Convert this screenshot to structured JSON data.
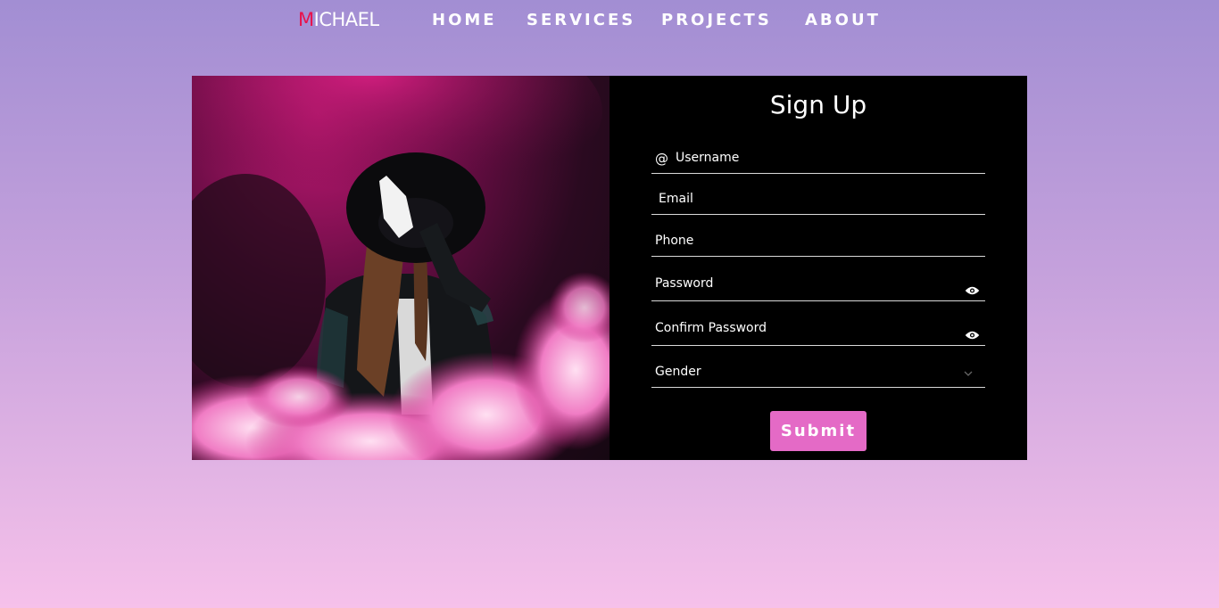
{
  "nav": {
    "logo_first": "M",
    "logo_rest": "ICHAEL",
    "links": [
      "HOME",
      "SERVICES",
      "PROJECTS",
      "ABOUT"
    ]
  },
  "form": {
    "title": "Sign Up",
    "username_icon": "@",
    "fields": {
      "username": "Username",
      "email": "Email",
      "phone": "Phone",
      "password": "Password",
      "confirm_password": "Confirm Password",
      "gender": "Gender"
    },
    "submit_label": "Submit"
  },
  "colors": {
    "logo_accent": "#e8124c",
    "submit_bg": "#e46ac6",
    "panel_bg": "#000000"
  },
  "icons": {
    "password_toggle": "eye-icon",
    "gender_dropdown": "chevron-down-icon"
  }
}
